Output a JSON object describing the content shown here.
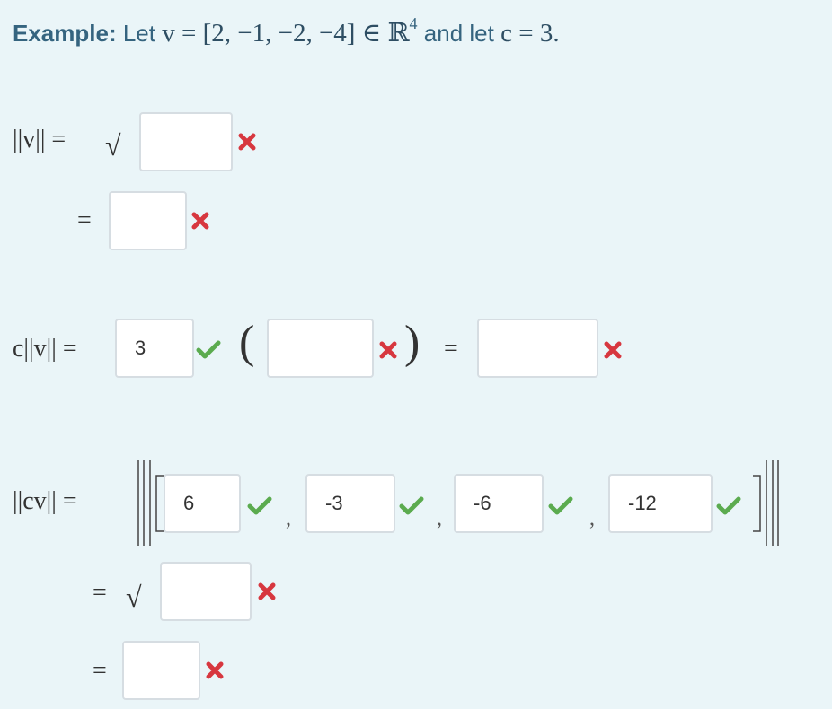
{
  "header": {
    "example_label": "Example:",
    "let_text": "Let",
    "vector_expr": "v = [2, −1, −2, −4] ∈ ℝ",
    "superscript": "4",
    "and_text": "and let",
    "scalar_expr": "c = 3."
  },
  "norm_v": {
    "label": "||v|| =",
    "equals": "=",
    "sqrt_symbol": "√",
    "input1": "",
    "input2": ""
  },
  "c_norm_v": {
    "label": "c||v|| =",
    "input_c": "3",
    "open_paren": "(",
    "close_paren": ")",
    "equals": "=",
    "input_inner": "",
    "input_result": ""
  },
  "norm_cv": {
    "label": "||cv|| =",
    "open_bracket": "||[",
    "close_bracket": "]||",
    "components": [
      "6",
      "-3",
      "-6",
      "-12"
    ],
    "equals1": "=",
    "sqrt_symbol": "√",
    "input_sqrt": "",
    "equals2": "=",
    "input_final": ""
  },
  "colors": {
    "background": "#eaf5f8",
    "header_text": "#35647f",
    "correct": "#5bab4f",
    "incorrect": "#d7373f",
    "input_border": "#d6dde2"
  }
}
